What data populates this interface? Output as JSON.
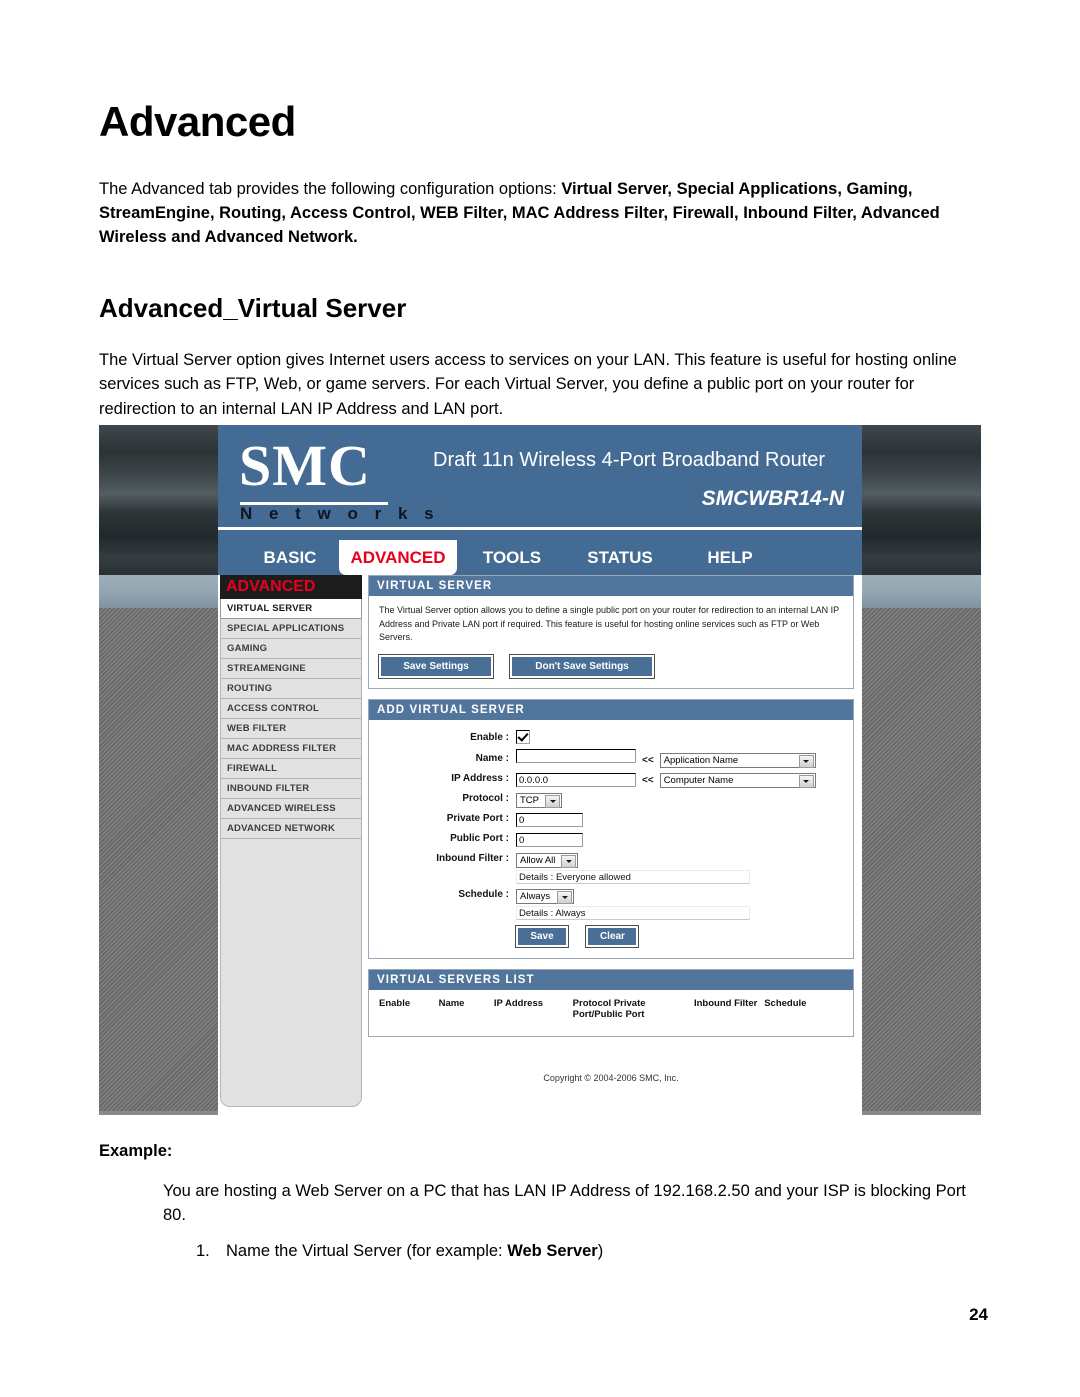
{
  "document": {
    "h1": "Advanced",
    "intro_plain_1": "The Advanced tab provides the following configuration options: ",
    "intro_bold": "Virtual Server, Special Applications, Gaming, StreamEngine, Routing, Access Control, WEB Filter, MAC Address Filter, Firewall, Inbound Filter, Advanced Wireless and Advanced Network.",
    "h2": "Advanced_Virtual Server",
    "paragraph": "The Virtual Server option gives Internet users access to services on your LAN. This feature is useful for hosting online services such as FTP, Web, or game servers. For each Virtual Server, you define a public port on your router for redirection to an internal LAN IP Address and LAN port.",
    "example_label": "Example:",
    "example_body": "You are hosting a Web Server on a PC that has LAN IP Address of 192.168.2.50 and your ISP is blocking Port 80.",
    "example_step_number": "1.",
    "example_step_text_1": "Name the Virtual Server (for example: ",
    "example_step_bold": "Web Server",
    "example_step_text_2": ")",
    "page_number": "24"
  },
  "router_ui": {
    "brand": "SMC",
    "brand_sub": "N e t w o r k s",
    "product_name": "Draft 11n Wireless 4-Port Broadband Router",
    "model": "SMCWBR14-N",
    "nav_tabs": [
      {
        "label": "BASIC",
        "active": false
      },
      {
        "label": "ADVANCED",
        "active": true
      },
      {
        "label": "TOOLS",
        "active": false
      },
      {
        "label": "STATUS",
        "active": false
      },
      {
        "label": "HELP",
        "active": false
      }
    ],
    "sidebar": {
      "title": "ADVANCED",
      "items": [
        {
          "label": "VIRTUAL SERVER",
          "active": true
        },
        {
          "label": "SPECIAL APPLICATIONS",
          "active": false
        },
        {
          "label": "GAMING",
          "active": false
        },
        {
          "label": "STREAMENGINE",
          "active": false
        },
        {
          "label": "ROUTING",
          "active": false
        },
        {
          "label": "ACCESS CONTROL",
          "active": false
        },
        {
          "label": "WEB FILTER",
          "active": false
        },
        {
          "label": "MAC ADDRESS FILTER",
          "active": false
        },
        {
          "label": "FIREWALL",
          "active": false
        },
        {
          "label": "INBOUND FILTER",
          "active": false
        },
        {
          "label": "ADVANCED WIRELESS",
          "active": false
        },
        {
          "label": "ADVANCED NETWORK",
          "active": false
        }
      ]
    },
    "virtual_server_panel": {
      "header": "VIRTUAL SERVER",
      "description": "The Virtual Server option allows you to define a single public port on your router for redirection to an internal LAN IP Address and Private LAN port if required. This feature is useful for hosting online services such as FTP or Web Servers.",
      "save_button": "Save Settings",
      "dont_save_button": "Don't Save Settings"
    },
    "add_virtual_server_panel": {
      "header": "ADD VIRTUAL SERVER",
      "labels": {
        "enable": "Enable :",
        "name": "Name :",
        "ip_address": "IP Address :",
        "protocol": "Protocol :",
        "private_port": "Private Port :",
        "public_port": "Public Port :",
        "inbound_filter": "Inbound Filter :",
        "schedule": "Schedule :"
      },
      "values": {
        "enable_checked": "checked",
        "name": "",
        "application_name_select": "Application Name",
        "ip_address": "0.0.0.0",
        "computer_name_select": "Computer Name",
        "protocol": "TCP",
        "private_port": "0",
        "public_port": "0",
        "inbound_filter": "Allow All",
        "inbound_details": "Details : Everyone allowed",
        "schedule": "Always",
        "schedule_details": "Details : Always"
      },
      "arrows": "<<",
      "save_button": "Save",
      "clear_button": "Clear"
    },
    "virtual_servers_list_panel": {
      "header": "VIRTUAL SERVERS LIST",
      "columns": [
        "Enable",
        "Name",
        "IP Address",
        "Protocol Private Port/Public Port",
        "Inbound Filter",
        "Schedule"
      ],
      "rows": []
    },
    "copyright": "Copyright © 2004-2006 SMC, Inc."
  },
  "colors": {
    "header_blue": "#446b93",
    "panel_head_blue": "#52759c",
    "button_blue": "#4a6f96",
    "active_tab_red": "#e8001c",
    "sidebar_title_bg": "#1c1c1c"
  }
}
